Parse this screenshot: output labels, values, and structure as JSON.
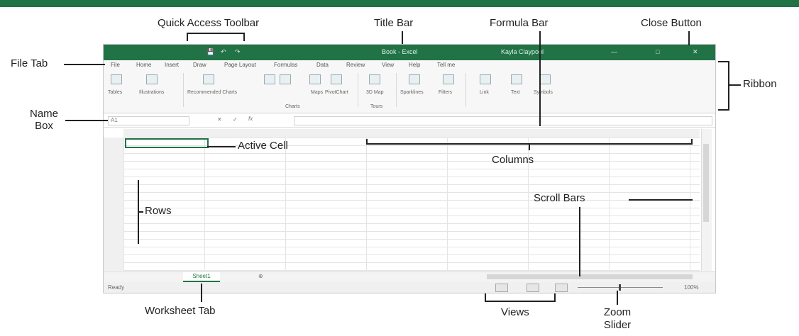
{
  "callouts": {
    "quick_access_toolbar": "Quick Access Toolbar",
    "title_bar": "Title Bar",
    "formula_bar": "Formula Bar",
    "close_button": "Close Button",
    "file_tab": "File Tab",
    "ribbon": "Ribbon",
    "name_box": "Name Box",
    "active_cell": "Active Cell",
    "columns": "Columns",
    "rows": "Rows",
    "scroll_bars": "Scroll Bars",
    "worksheet_tab": "Worksheet Tab",
    "views": "Views",
    "zoom_slider": "Zoom Slider"
  },
  "excel": {
    "title": "Book - Excel",
    "user": "Kayla Claypool",
    "tabs": [
      "File",
      "Home",
      "Insert",
      "Draw",
      "Page Layout",
      "Formulas",
      "Data",
      "Review",
      "View",
      "Help",
      "Tell me"
    ],
    "ribbon_labels": [
      "Tables",
      "Illustrations",
      "Recommended Charts",
      "Maps",
      "PivotChart",
      "3D Map",
      "Sparklines",
      "Filters",
      "Link",
      "Text",
      "Symbols"
    ],
    "group_labels": [
      "Charts",
      "Tours"
    ],
    "name_box_value": "A1",
    "sheet_tab": "Sheet1",
    "status": "Ready",
    "zoom": "100%"
  },
  "colors": {
    "excel_green": "#217346"
  }
}
